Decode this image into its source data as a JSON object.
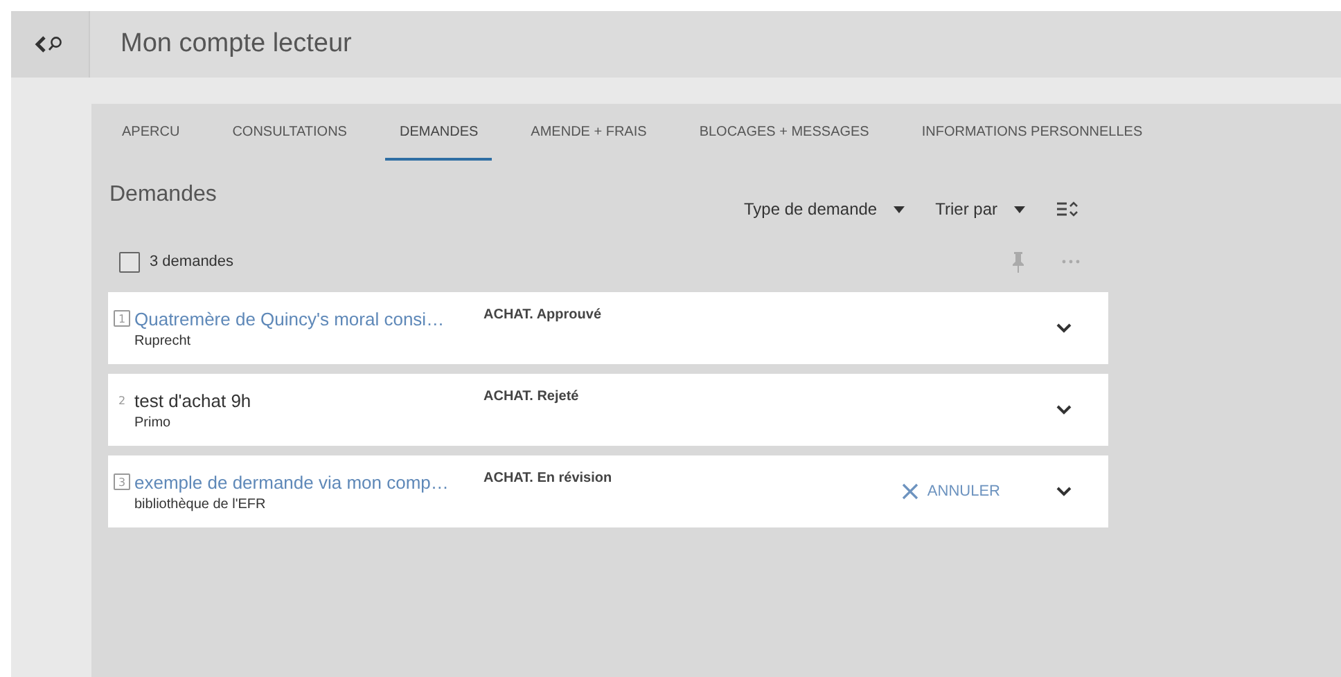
{
  "header": {
    "title": "Mon compte lecteur"
  },
  "tabs": [
    {
      "label": "APERCU",
      "selected": false
    },
    {
      "label": "CONSULTATIONS",
      "selected": false
    },
    {
      "label": "DEMANDES",
      "selected": true
    },
    {
      "label": "AMENDE + FRAIS",
      "selected": false
    },
    {
      "label": "BLOCAGES + MESSAGES",
      "selected": false
    },
    {
      "label": "INFORMATIONS PERSONNELLES",
      "selected": false
    }
  ],
  "section": {
    "title": "Demandes",
    "filters": [
      "Type de demande",
      "Trier par"
    ]
  },
  "select_all": {
    "checked": false,
    "label": "3 demandes"
  },
  "requests": [
    {
      "number": "1",
      "link": true,
      "title": "Quatremère de Quincy's moral consi…",
      "source": "Ruprecht",
      "status": "ACHAT. Approuvé"
    },
    {
      "number": "2",
      "link": false,
      "title": "test d'achat 9h",
      "source": "Primo",
      "status": "ACHAT. Rejeté"
    },
    {
      "number": "3",
      "link": true,
      "title": "exemple de dermande via mon comp…",
      "source": "bibliothèque de l'EFR",
      "status": "ACHAT. En révision",
      "action": "ANNULER"
    }
  ]
}
